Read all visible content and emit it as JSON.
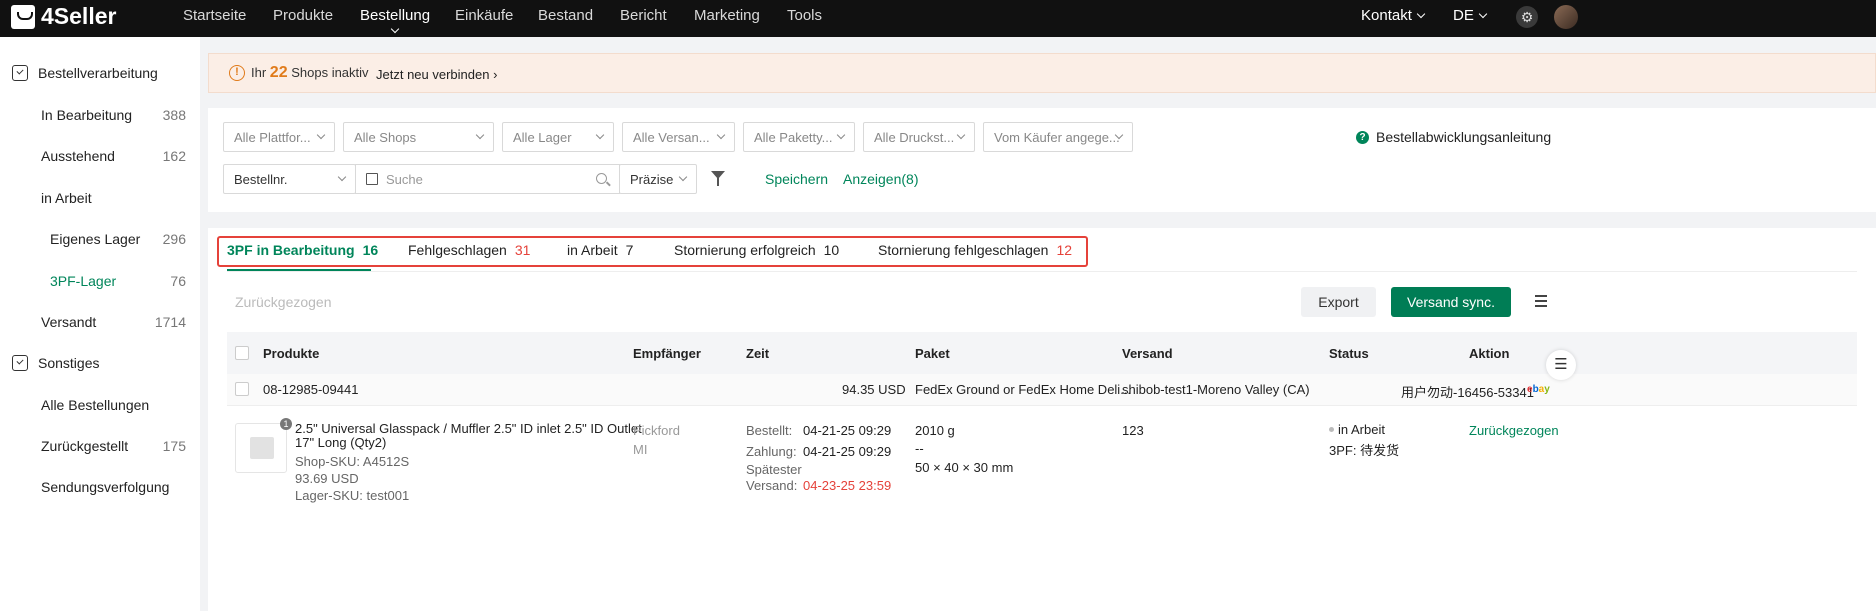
{
  "app": {
    "logo": "4Seller"
  },
  "topnav": {
    "items": [
      "Startseite",
      "Produkte",
      "Bestellung",
      "Einkäufe",
      "Bestand",
      "Bericht",
      "Marketing",
      "Tools"
    ],
    "active": "Bestellung",
    "contact": "Kontakt",
    "language": "DE"
  },
  "sidebar": {
    "group1": "Bestellverarbeitung",
    "items1": [
      {
        "label": "In Bearbeitung",
        "count": "388"
      },
      {
        "label": "Ausstehend",
        "count": "162"
      },
      {
        "label": "in Arbeit",
        "count": ""
      },
      {
        "label": "Eigenes Lager",
        "count": "296"
      },
      {
        "label": "3PF-Lager",
        "count": "76"
      },
      {
        "label": "Versandt",
        "count": "1714"
      }
    ],
    "group2": "Sonstiges",
    "items2": [
      {
        "label": "Alle Bestellungen",
        "count": ""
      },
      {
        "label": "Zurückgestellt",
        "count": "175"
      },
      {
        "label": "Sendungsverfolgung",
        "count": ""
      }
    ]
  },
  "banner": {
    "prefix": "Ihr",
    "count": "22",
    "suffix": "Shops inaktiv",
    "link": "Jetzt neu verbinden"
  },
  "filters": {
    "dropdowns": [
      "Alle Plattfor...",
      "Alle Shops",
      "Alle Lager",
      "Alle Versan...",
      "Alle Paketty...",
      "Alle Druckst...",
      "Vom Käufer angege..."
    ],
    "field_select": "Bestellnr.",
    "search_placeholder": "Suche",
    "match_select": "Präzise",
    "save": "Speichern",
    "show": "Anzeigen(8)",
    "help": "Bestellabwicklungsanleitung"
  },
  "tabs": [
    {
      "label": "3PF in Bearbeitung",
      "count": "16"
    },
    {
      "label": "Fehlgeschlagen",
      "count": "31"
    },
    {
      "label": "in Arbeit",
      "count": "7"
    },
    {
      "label": "Stornierung erfolgreich",
      "count": "10"
    },
    {
      "label": "Stornierung fehlgeschlagen",
      "count": "12"
    }
  ],
  "actions": {
    "withdrawn": "Zurückgezogen",
    "export": "Export",
    "sync": "Versand sync."
  },
  "table": {
    "headers": [
      "Produkte",
      "Empfänger",
      "Zeit",
      "Paket",
      "Versand",
      "Status",
      "Aktion"
    ]
  },
  "order": {
    "number": "08-12985-09441",
    "total": "94.35 USD",
    "carrier": "FedEx Ground or FedEx Home Deli...",
    "warehouse": "shibob-test1-Moreno Valley (CA)",
    "buyer": "用户勿动-16456-53341",
    "platform": "ebay",
    "product": {
      "qty_badge": "1",
      "title_line1": "2.5\" Universal Glasspack / Muffler 2.5\" ID inlet 2.5\" ID Outlet",
      "title_line2": "17\" Long (Qty2)",
      "shop_sku": "Shop-SKU: A4512S",
      "price": "93.69 USD",
      "stock_sku": "Lager-SKU: test001"
    },
    "recipient_name": "Pickford",
    "recipient_state": "MI",
    "time": {
      "ordered_label": "Bestellt:",
      "ordered": "04-21-25 09:29",
      "paid_label": "Zahlung:",
      "paid": "04-21-25 09:29",
      "latest_label_1": "Spätester",
      "latest_label_2": "Versand:",
      "latest": "04-23-25 23:59"
    },
    "package": {
      "weight": "2010 g",
      "dash": "--",
      "dims": "50 × 40 × 30 mm"
    },
    "shipping": "123",
    "status": "in Arbeit",
    "status_3pf": "3PF: 待发货",
    "action": "Zurückgezogen"
  },
  "colors": {
    "accent": "#00855a",
    "alert": "#e5423a",
    "warning": "#e07b1b"
  }
}
